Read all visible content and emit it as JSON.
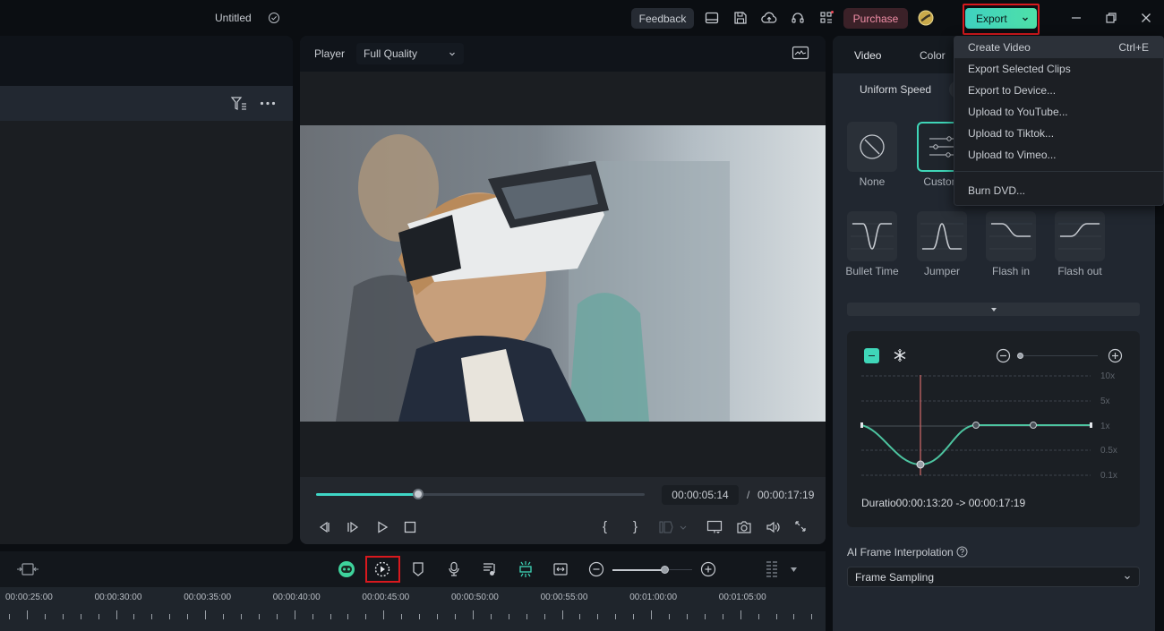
{
  "titlebar": {
    "project_title": "Untitled",
    "feedback_label": "Feedback",
    "purchase_label": "Purchase",
    "export_label": "Export",
    "icons": [
      "check-circle-icon",
      "layout-icon",
      "save-icon",
      "cloud-upload-icon",
      "headset-icon",
      "apps-grid-icon",
      "avatar-icon",
      "minimize-icon",
      "restore-icon",
      "close-icon"
    ]
  },
  "export_menu": {
    "items": [
      {
        "label": "Create Video",
        "shortcut": "Ctrl+E",
        "active": true
      },
      {
        "label": "Export Selected Clips"
      },
      {
        "label": "Export to Device..."
      },
      {
        "label": "Upload to YouTube..."
      },
      {
        "label": "Upload to Tiktok..."
      },
      {
        "label": "Upload to Vimeo..."
      },
      {
        "label": "Burn DVD..."
      }
    ]
  },
  "player": {
    "label": "Player",
    "quality": "Full Quality",
    "current_time": "00:00:05:14",
    "separator": "/",
    "total_time": "00:00:17:19",
    "progress": 0.31
  },
  "right_panel": {
    "tabs": [
      "Video",
      "Color"
    ],
    "speed_mode": "Uniform Speed",
    "presets": [
      {
        "label": "None"
      },
      {
        "label": "Custom",
        "selected": true
      },
      {
        "label": "Bullet Time"
      },
      {
        "label": "Jumper"
      },
      {
        "label": "Flash in"
      },
      {
        "label": "Flash out"
      }
    ],
    "curve": {
      "y_labels": [
        "10x",
        "5x",
        "1x",
        "0.5x",
        "0.1x"
      ],
      "duration_text": "Duratio00:00:13:20 -> 00:00:17:19",
      "zoom_level": 0.0
    },
    "ai_interp_label": "AI Frame Interpolation",
    "ai_interp_value": "Frame Sampling"
  },
  "timeline": {
    "ruler_labels": [
      "00:00:25:00",
      "00:00:30:00",
      "00:00:35:00",
      "00:00:40:00",
      "00:00:45:00",
      "00:00:50:00",
      "00:00:55:00",
      "00:01:00:00",
      "00:01:05:00"
    ],
    "zoom_level": 0.65
  },
  "colors": {
    "accent": "#3fd6b8",
    "highlight": "#d8191e",
    "purchase": "#f08ea6"
  }
}
